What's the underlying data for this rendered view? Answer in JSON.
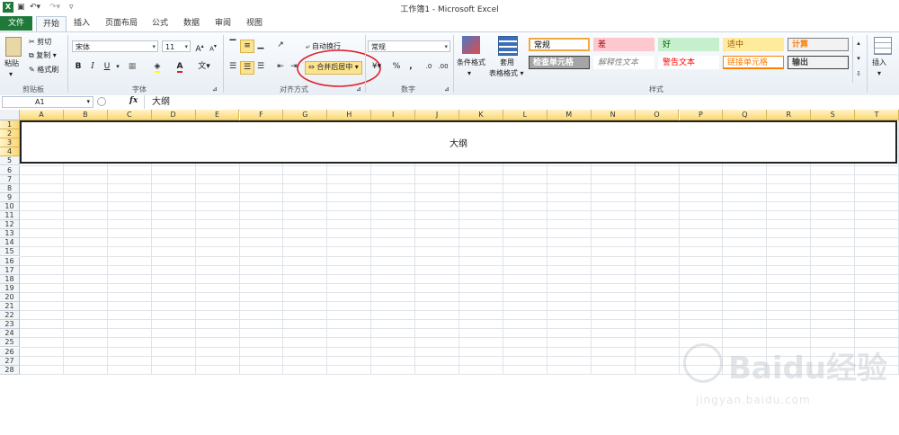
{
  "window": {
    "title": "工作簿1 - Microsoft Excel"
  },
  "quick_access": {
    "save_icon": "save-icon",
    "undo_icon": "undo-icon",
    "redo_icon": "redo-icon"
  },
  "tabs": [
    {
      "label": "文件"
    },
    {
      "label": "开始"
    },
    {
      "label": "插入"
    },
    {
      "label": "页面布局"
    },
    {
      "label": "公式"
    },
    {
      "label": "数据"
    },
    {
      "label": "审阅"
    },
    {
      "label": "视图"
    }
  ],
  "clipboard": {
    "paste": "粘贴",
    "cut": "剪切",
    "copy": "复制 ▾",
    "format_painter": "格式刷",
    "group": "剪贴板"
  },
  "font": {
    "name": "宋体",
    "size": "11",
    "group": "字体"
  },
  "alignment": {
    "wrap": "自动换行",
    "merge": "合并后居中",
    "group": "对齐方式"
  },
  "number": {
    "format": "常规",
    "percent": "%",
    "comma": ",",
    "group": "数字"
  },
  "styles_group": {
    "conditional": "条件格式",
    "table_format_1": "套用",
    "table_format_2": "表格格式",
    "group": "样式",
    "cells": [
      {
        "label": "常规",
        "bg": "#ffffff",
        "fg": "#000000",
        "border": "#f2a93b"
      },
      {
        "label": "差",
        "bg": "#ffc7ce",
        "fg": "#9c0006",
        "border": "#ffc7ce"
      },
      {
        "label": "好",
        "bg": "#c6efce",
        "fg": "#006100",
        "border": "#c6efce"
      },
      {
        "label": "适中",
        "bg": "#ffeb9c",
        "fg": "#9c5700",
        "border": "#ffeb9c"
      },
      {
        "label": "计算",
        "bg": "#f2f2f2",
        "fg": "#fa7d00",
        "border": "#7f7f7f"
      },
      {
        "label": "检查单元格",
        "bg": "#a5a5a5",
        "fg": "#ffffff",
        "border": "#3f3f3f"
      },
      {
        "label": "解释性文本",
        "bg": "#ffffff",
        "fg": "#7f7f7f",
        "border": "#ffffff"
      },
      {
        "label": "警告文本",
        "bg": "#ffffff",
        "fg": "#ff0000",
        "border": "#ffffff"
      },
      {
        "label": "链接单元格",
        "bg": "#ffffff",
        "fg": "#fa7d00",
        "border": "#ff8001"
      },
      {
        "label": "输出",
        "bg": "#f2f2f2",
        "fg": "#3f3f3f",
        "border": "#3f3f3f"
      }
    ]
  },
  "cells_group": {
    "insert": "插入"
  },
  "formula_bar": {
    "name_box": "A1",
    "fx": "fx",
    "value": "大纲"
  },
  "sheet": {
    "columns": [
      "A",
      "B",
      "C",
      "D",
      "E",
      "F",
      "G",
      "H",
      "I",
      "J",
      "K",
      "L",
      "M",
      "N",
      "O",
      "P",
      "Q",
      "R",
      "S",
      "T"
    ],
    "rows": [
      "1",
      "2",
      "3",
      "4",
      "5",
      "6",
      "7",
      "8",
      "9",
      "10",
      "11",
      "12",
      "13",
      "14",
      "15",
      "16",
      "17",
      "18",
      "19",
      "20",
      "21",
      "22",
      "23",
      "24",
      "25",
      "26",
      "27",
      "28"
    ],
    "merged_text": "大纲"
  },
  "watermark": {
    "brand": "Baidu经验",
    "url": "jingyan.baidu.com"
  },
  "colors": {
    "file_tab": "#1f7a3a",
    "selection_header": "#fbd874",
    "annotation_circle": "#e0202a"
  }
}
